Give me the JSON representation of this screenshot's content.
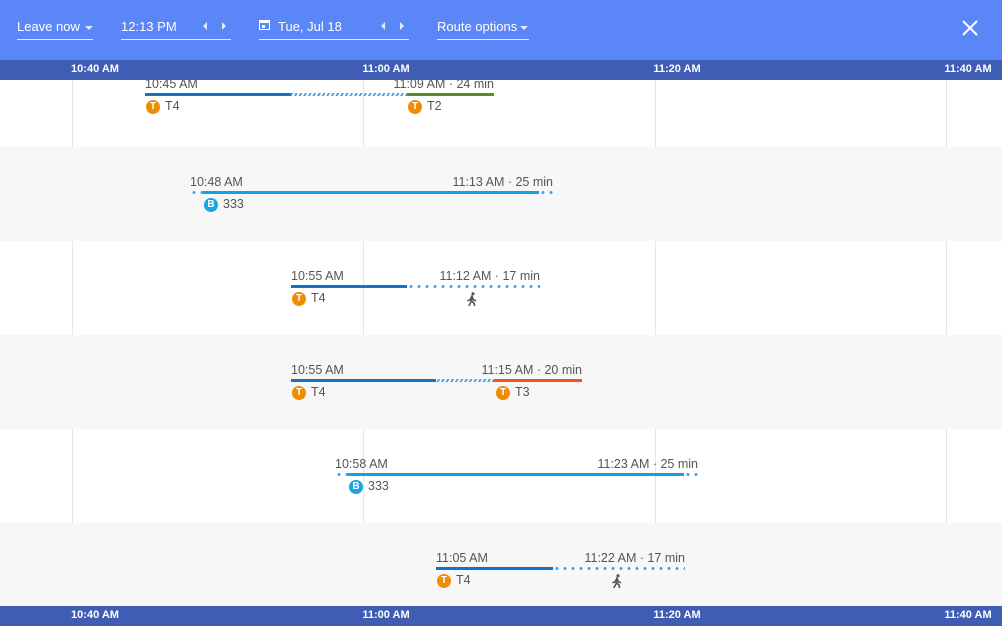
{
  "toolbar": {
    "depart_mode": "Leave now",
    "time": "12:13 PM",
    "date": "Tue, Jul 18",
    "route_options": "Route options"
  },
  "axis_ticks": [
    "10:40 AM",
    "11:00 AM",
    "11:20 AM",
    "11:40 AM"
  ],
  "colors": {
    "header": "#5b86f7",
    "axis": "#3f5db3",
    "tram_badge": "#f08c00",
    "bus_badge": "#1aa5e0",
    "T4": "#1473c2",
    "T2": "#5b8f22",
    "T3": "#f4511e",
    "bus_333": "#14a0e6"
  },
  "routes": [
    {
      "depart": "10:45 AM",
      "arrive_info": "11:09 AM · 24 min",
      "legs": [
        {
          "type": "tram",
          "line": "T4"
        },
        {
          "type": "transfer"
        },
        {
          "type": "tram",
          "line": "T2"
        }
      ]
    },
    {
      "depart": "10:48 AM",
      "arrive_info": "11:13 AM · 25 min",
      "legs": [
        {
          "type": "bus",
          "line": "333"
        }
      ]
    },
    {
      "depart": "10:55 AM",
      "arrive_info": "11:12 AM · 17 min",
      "legs": [
        {
          "type": "tram",
          "line": "T4"
        },
        {
          "type": "walk"
        }
      ]
    },
    {
      "depart": "10:55 AM",
      "arrive_info": "11:15 AM · 20 min",
      "legs": [
        {
          "type": "tram",
          "line": "T4"
        },
        {
          "type": "transfer"
        },
        {
          "type": "tram",
          "line": "T3"
        }
      ]
    },
    {
      "depart": "10:58 AM",
      "arrive_info": "11:23 AM · 25 min",
      "legs": [
        {
          "type": "bus",
          "line": "333"
        }
      ]
    },
    {
      "depart": "11:05 AM",
      "arrive_info": "11:22 AM · 17 min",
      "legs": [
        {
          "type": "tram",
          "line": "T4"
        },
        {
          "type": "walk"
        }
      ]
    }
  ],
  "badges": {
    "tram": "T",
    "bus": "B"
  }
}
